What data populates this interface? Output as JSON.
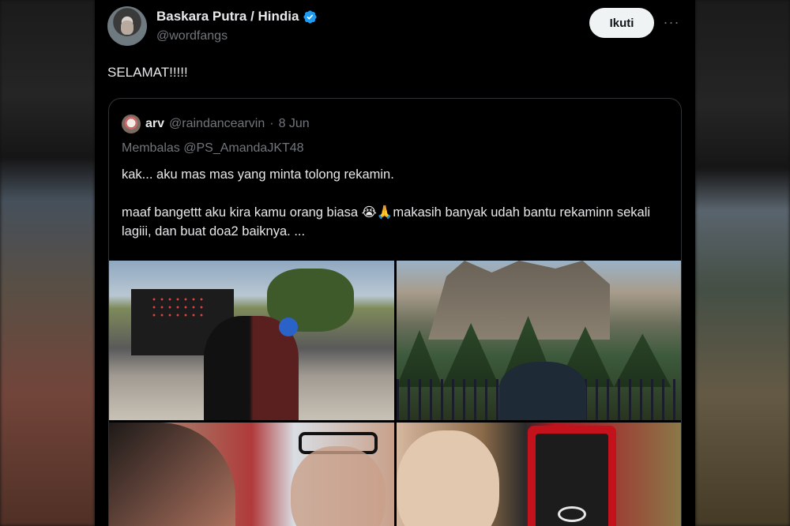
{
  "post": {
    "display_name": "Baskara Putra / Hindia",
    "handle": "@wordfangs",
    "follow_label": "Ikuti",
    "more_label": "···",
    "text": "SELAMAT!!!!!"
  },
  "quoted": {
    "name": "arv",
    "handle": "@raindancearvin",
    "dot": "·",
    "date": "8 Jun",
    "reply_to": "Membalas @PS_AmandaJKT48",
    "para1": "kak... aku mas mas yang minta tolong rekamin.",
    "para2": "maaf bangettt aku kira kamu orang biasa 😭🙏makasih banyak udah bantu rekaminn sekali lagiii, dan buat doa2 baiknya. ...",
    "photos": [
      {
        "name": "concert-photo"
      },
      {
        "name": "castle-photo"
      },
      {
        "name": "selfie-photo"
      },
      {
        "name": "ring-photo"
      }
    ]
  },
  "colors": {
    "background": "#000000",
    "text": "#e7e9ea",
    "muted": "#71767b",
    "verified": "#1d9bf0",
    "border": "#2f3336"
  },
  "icons": [
    "verified-badge-icon",
    "more-icon"
  ]
}
